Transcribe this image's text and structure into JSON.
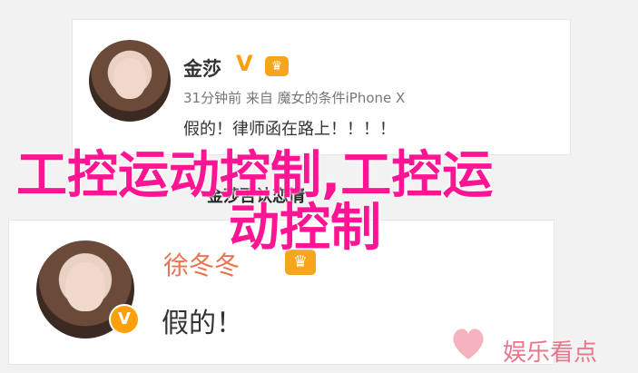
{
  "post1": {
    "author": "金莎",
    "verified_mark": "V",
    "meta": "31分钟前 来自 魔女的条件iPhone X",
    "content": "假的！律师函在路上！！！！"
  },
  "caption": "金莎否认恋情",
  "post2": {
    "author": "徐冬冬",
    "content": "假的！"
  },
  "overlay": {
    "line1": "工控运动控制,工控运",
    "line2": "动控制"
  },
  "watermark": {
    "text": "娱乐看点"
  },
  "colors": {
    "overlay_pink": "#ff1493",
    "name_orange": "#eb7350",
    "vip_gold": "#ffa00a",
    "watermark_pink": "#e8778b"
  }
}
